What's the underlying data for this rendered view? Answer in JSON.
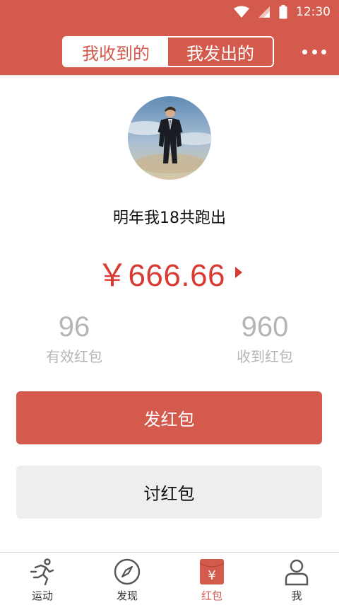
{
  "status_bar": {
    "time": "12:30"
  },
  "header": {
    "tabs": [
      {
        "label": "我收到的",
        "active": true
      },
      {
        "label": "我发出的",
        "active": false
      }
    ],
    "more_icon": "more-dots-icon"
  },
  "profile": {
    "name": "明年我18共跑出",
    "amount": "￥666.66",
    "stats": [
      {
        "value": "96",
        "label": "有效红包"
      },
      {
        "value": "960",
        "label": "收到红包"
      }
    ]
  },
  "actions": {
    "send_label": "发红包",
    "ask_label": "讨红包"
  },
  "bottom_nav": [
    {
      "label": "运动",
      "icon": "running-icon",
      "active": false
    },
    {
      "label": "发现",
      "icon": "compass-icon",
      "active": false
    },
    {
      "label": "红包",
      "icon": "red-envelope-icon",
      "active": true
    },
    {
      "label": "我",
      "icon": "person-icon",
      "active": false
    }
  ],
  "colors": {
    "brand": "#d35a4c",
    "amount": "#d93a32",
    "muted": "#b5b5b5"
  }
}
